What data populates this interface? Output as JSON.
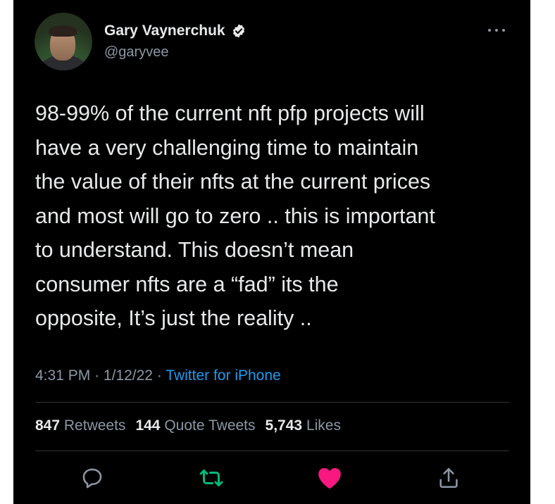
{
  "author": {
    "name": "Gary Vaynerchuk",
    "handle": "@garyvee",
    "verified": true
  },
  "tweet": {
    "text": "98-99% of the current nft pfp projects will\nhave a very challenging time to maintain\nthe value of their nfts at the current prices\nand most will go to zero .. this is important\nto understand. This doesn’t mean\nconsumer nfts are a “fad” its the\nopposite, It’s just the reality ..",
    "time": "4:31 PM",
    "date": "1/12/22",
    "separator": "·",
    "source": "Twitter for iPhone"
  },
  "stats": {
    "retweets_count": "847",
    "retweets_label": "Retweets",
    "quotes_count": "144",
    "quotes_label": "Quote Tweets",
    "likes_count": "5,743",
    "likes_label": "Likes"
  },
  "actions": {
    "reply_icon": "reply-icon",
    "retweet_icon": "retweet-icon",
    "like_icon": "heart-icon",
    "share_icon": "share-icon"
  },
  "colors": {
    "background": "#000000",
    "text": "#e7e9ea",
    "muted": "#8b98a5",
    "link": "#1d9bf0",
    "retweet": "#00ba7c",
    "like": "#f91880"
  }
}
